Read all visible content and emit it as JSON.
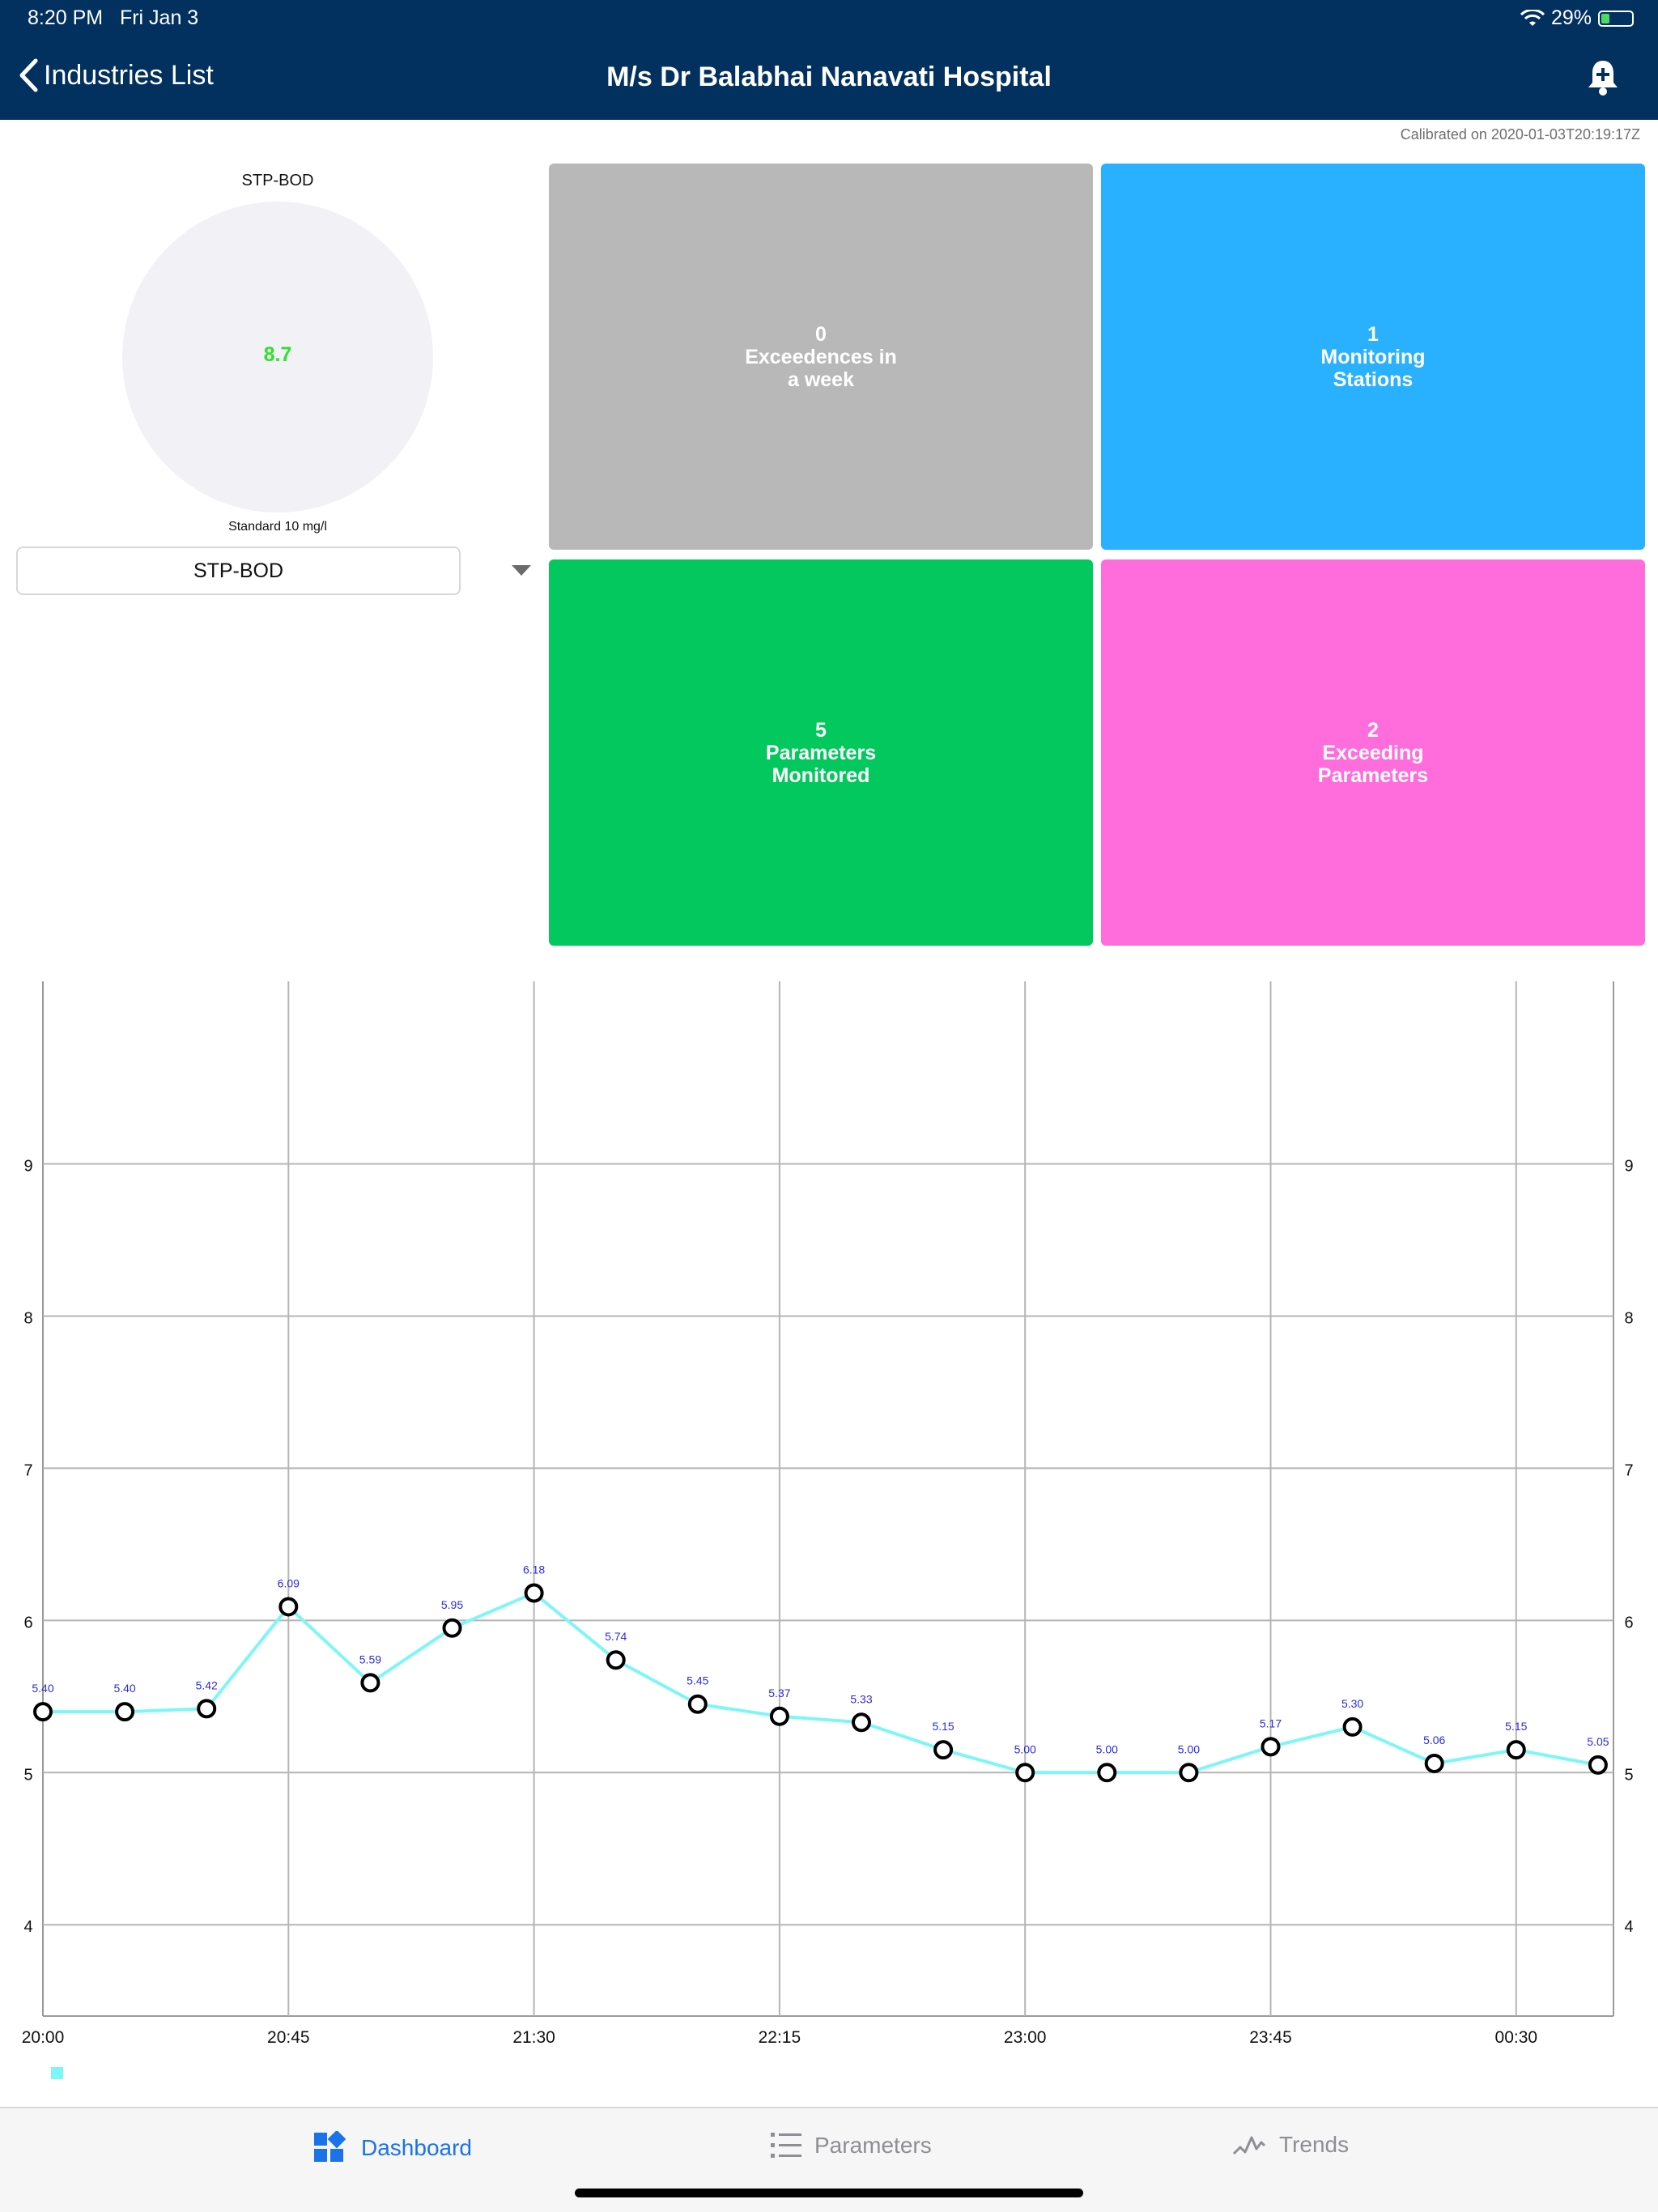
{
  "status_bar": {
    "time": "8:20 PM",
    "date": "Fri Jan 3",
    "battery": "29%",
    "battery_level": 0.29
  },
  "nav": {
    "back_label": "Industries List",
    "title": "M/s Dr Balabhai Nanavati Hospital",
    "bell_icon": "bell-plus-icon"
  },
  "calibrated": "Calibrated on 2020-01-03T20:19:17Z",
  "gauge": {
    "label": "STP-BOD",
    "value": "8.7",
    "standard": "Standard 10 mg/l",
    "value_color": "#2fe02f"
  },
  "parameter_select": {
    "selected": "STP-BOD"
  },
  "tiles": [
    {
      "number": "0",
      "line1": "Exceedences in",
      "line2": "a week",
      "color": "#b8b8b8"
    },
    {
      "number": "1",
      "line1": "Monitoring",
      "line2": "Stations",
      "color": "#29b0ff"
    },
    {
      "number": "5",
      "line1": "Parameters",
      "line2": "Monitored",
      "color": "#02c85d"
    },
    {
      "number": "2",
      "line1": "Exceeding",
      "line2": "Parameters",
      "color": "#ff6ddd"
    }
  ],
  "chart_data": {
    "type": "line",
    "line_color": "#7ff6f6",
    "label_color": "#2b2be0",
    "x_tick_labels": [
      "20:00",
      "20:45",
      "21:30",
      "22:15",
      "23:00",
      "23:45",
      "00:30"
    ],
    "y_ticks": [
      4,
      5,
      6,
      7,
      8,
      9
    ],
    "ylim": [
      3.4,
      10.2
    ],
    "x": [
      "20:00",
      "20:15",
      "20:30",
      "20:45",
      "21:00",
      "21:15",
      "21:30",
      "21:45",
      "22:00",
      "22:15",
      "22:30",
      "22:45",
      "23:00",
      "23:15",
      "23:30",
      "23:45",
      "00:00",
      "00:15",
      "00:30",
      "00:45"
    ],
    "values": [
      5.4,
      5.4,
      5.42,
      6.09,
      5.59,
      5.95,
      6.18,
      5.74,
      5.45,
      5.37,
      5.33,
      5.15,
      5.0,
      5.0,
      5.0,
      5.17,
      5.3,
      5.06,
      5.15,
      5.05
    ],
    "value_labels": [
      "5.40",
      "5.40",
      "5.42",
      "6.09",
      "5.59",
      "5.95",
      "6.18",
      "5.74",
      "5.45",
      "5.37",
      "5.33",
      "5.15",
      "5.00",
      "5.00",
      "5.00",
      "5.17",
      "5.30",
      "5.06",
      "5.15",
      "5.05"
    ],
    "grid": true,
    "legend": "bottom-left"
  },
  "tabbar": {
    "items": [
      {
        "label": "Dashboard",
        "icon": "dashboard-icon",
        "active": true
      },
      {
        "label": "Parameters",
        "icon": "list-icon",
        "active": false
      },
      {
        "label": "Trends",
        "icon": "trends-icon",
        "active": false
      }
    ]
  }
}
